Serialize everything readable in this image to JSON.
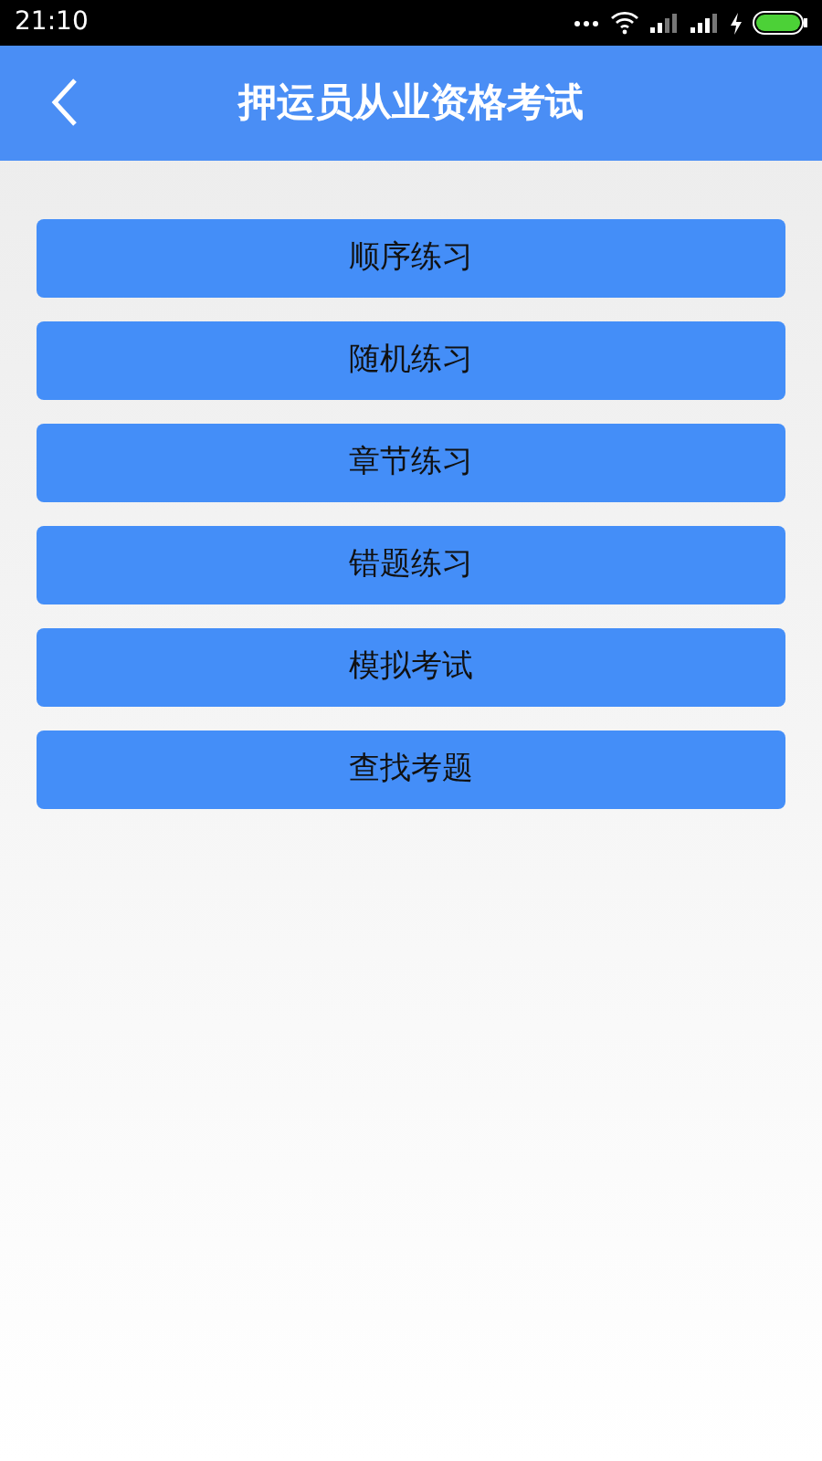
{
  "status_bar": {
    "time": "21:10"
  },
  "header": {
    "title": "押运员从业资格考试"
  },
  "menu": [
    {
      "label": "顺序练习"
    },
    {
      "label": "随机练习"
    },
    {
      "label": "章节练习"
    },
    {
      "label": "错题练习"
    },
    {
      "label": "模拟考试"
    },
    {
      "label": "查找考题"
    }
  ]
}
